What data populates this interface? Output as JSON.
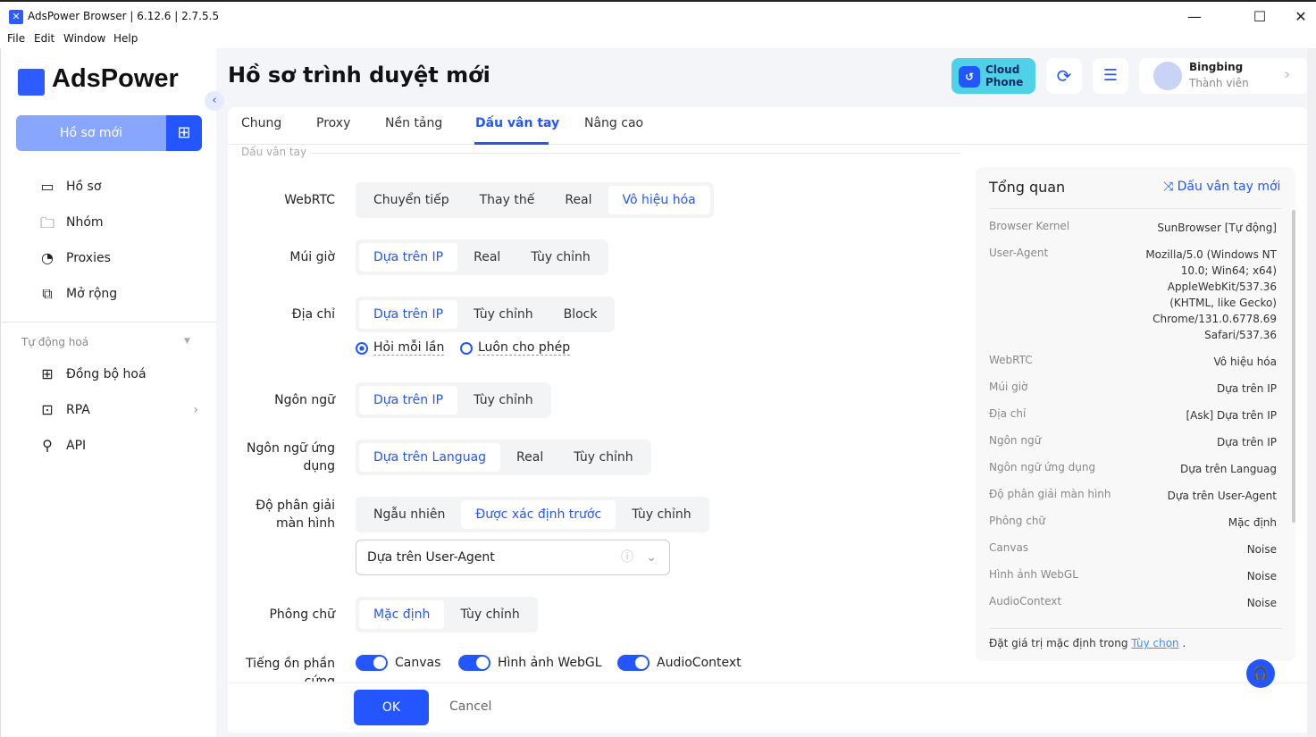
{
  "window": {
    "title": "AdsPower Browser | 6.12.6 | 2.7.5.5",
    "menu": [
      "File",
      "Edit",
      "Window",
      "Help"
    ]
  },
  "sidebar": {
    "logo": "AdsPower",
    "new_profile": "Hồ sơ mới",
    "items": [
      {
        "label": "Hồ sơ",
        "icon": "profile-icon"
      },
      {
        "label": "Nhóm",
        "icon": "folder-icon"
      },
      {
        "label": "Proxies",
        "icon": "proxy-icon"
      },
      {
        "label": "Mở rộng",
        "icon": "extension-icon"
      }
    ],
    "automation_label": "Tự động hoá",
    "auto_items": [
      {
        "label": "Đồng bộ hoá"
      },
      {
        "label": "RPA"
      },
      {
        "label": "API"
      }
    ]
  },
  "header": {
    "title": "Hồ sơ trình duyệt mới",
    "cloud_phone": "Cloud Phone",
    "user": {
      "name": "Bingbing",
      "role": "Thành viên"
    }
  },
  "tabs": [
    {
      "label": "Chung"
    },
    {
      "label": "Proxy"
    },
    {
      "label": "Nền tảng"
    },
    {
      "label": "Dấu vân tay",
      "active": true
    },
    {
      "label": "Nâng cao"
    }
  ],
  "section": "Dấu vân tay",
  "form": {
    "webrtc": {
      "label": "WebRTC",
      "options": [
        "Chuyển tiếp",
        "Thay thế",
        "Real",
        "Vô hiệu hóa"
      ],
      "selected": 3
    },
    "timezone": {
      "label": "Múi giờ",
      "options": [
        "Dựa trên IP",
        "Real",
        "Tùy chỉnh"
      ],
      "selected": 0
    },
    "location": {
      "label": "Địa chỉ",
      "options": [
        "Dựa trên IP",
        "Tùy chỉnh",
        "Block"
      ],
      "selected": 0,
      "radios": [
        "Hỏi mỗi lần",
        "Luôn cho phép"
      ],
      "radio_selected": 0
    },
    "language": {
      "label": "Ngôn ngữ",
      "options": [
        "Dựa trên IP",
        "Tùy chỉnh"
      ],
      "selected": 0
    },
    "ui_language": {
      "label": "Ngôn ngữ ứng dụng",
      "options": [
        "Dựa trên Languag",
        "Real",
        "Tùy chỉnh"
      ],
      "selected": 0
    },
    "resolution": {
      "label": "Độ phân giải màn hình",
      "options": [
        "Ngẫu nhiên",
        "Được xác định trước",
        "Tùy chỉnh"
      ],
      "selected": 1,
      "select_value": "Dựa trên User-Agent"
    },
    "fonts": {
      "label": "Phông chữ",
      "options": [
        "Mặc định",
        "Tùy chỉnh"
      ],
      "selected": 0
    },
    "noise": {
      "label": "Tiếng ồn phần cứng",
      "toggles": [
        "Canvas",
        "Hình ảnh WebGL",
        "AudioContext"
      ]
    }
  },
  "footer": {
    "ok": "OK",
    "cancel": "Cancel"
  },
  "overview": {
    "title": "Tổng quan",
    "new_fingerprint": "Dấu vân tay mới",
    "rows": [
      {
        "k": "Browser Kernel",
        "v": "SunBrowser [Tự động]"
      },
      {
        "k": "User-Agent",
        "v": "Mozilla/5.0 (Windows NT 10.0; Win64; x64) AppleWebKit/537.36 (KHTML, like Gecko) Chrome/131.0.6778.69 Safari/537.36"
      },
      {
        "k": "WebRTC",
        "v": "Vô hiệu hóa"
      },
      {
        "k": "Múi giờ",
        "v": "Dựa trên IP"
      },
      {
        "k": "Địa chỉ",
        "v": "[Ask] Dựa trên IP"
      },
      {
        "k": "Ngôn ngữ",
        "v": "Dựa trên IP"
      },
      {
        "k": "Ngôn ngữ ứng dụng",
        "v": "Dựa trên Languag"
      },
      {
        "k": "Độ phân giải màn hình",
        "v": "Dựa trên User-Agent"
      },
      {
        "k": "Phông chữ",
        "v": "Mặc định"
      },
      {
        "k": "Canvas",
        "v": "Noise"
      },
      {
        "k": "Hình ảnh WebGL",
        "v": "Noise"
      },
      {
        "k": "AudioContext",
        "v": "Noise"
      }
    ],
    "note": "Đặt giá trị mặc định trong",
    "note_link": "Tùy chọn",
    "note_end": "."
  },
  "colors": {
    "accent": "#2456ff",
    "cloud_phone": "#4fd1e8"
  }
}
